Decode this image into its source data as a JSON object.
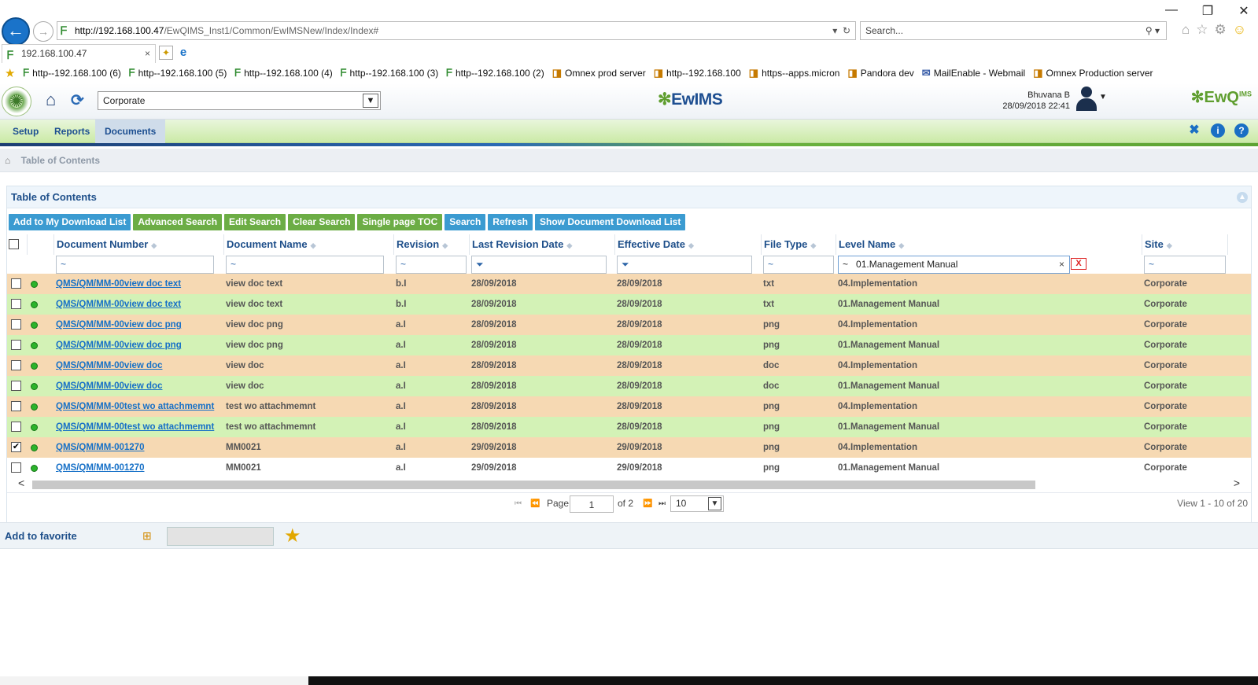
{
  "browser": {
    "url_host": "http://192.168.100.47",
    "url_path": "/EwQIMS_Inst1/Common/EwIMSNew/Index/Index#",
    "search_placeholder": "Search...",
    "tab_title": "192.168.100.47",
    "favorites": [
      {
        "label": "http--192.168.100 (6)",
        "icon": "ewims-favicon"
      },
      {
        "label": "http--192.168.100 (5)",
        "icon": "ewims-favicon"
      },
      {
        "label": "http--192.168.100 (4)",
        "icon": "ewims-favicon"
      },
      {
        "label": "http--192.168.100 (3)",
        "icon": "ewims-favicon"
      },
      {
        "label": "http--192.168.100 (2)",
        "icon": "ewims-favicon"
      },
      {
        "label": "Omnex prod server",
        "icon": "ie-page-icon"
      },
      {
        "label": "http--192.168.100",
        "icon": "ie-page-icon"
      },
      {
        "label": "https--apps.micron",
        "icon": "ie-page-icon"
      },
      {
        "label": "Pandora dev",
        "icon": "ie-page-icon"
      },
      {
        "label": "MailEnable - Webmail",
        "icon": "mail-icon"
      },
      {
        "label": "Omnex Production server",
        "icon": "ie-page-icon"
      }
    ]
  },
  "header": {
    "site_selected": "Corporate",
    "brand": "EwIMS",
    "user_name": "Bhuvana B",
    "datetime": "28/09/2018 22:41",
    "brand_right": "EwQ",
    "brand_right_sup": "IMS"
  },
  "menu": {
    "items": [
      "Setup",
      "Reports",
      "Documents"
    ],
    "active": "Documents"
  },
  "breadcrumb": {
    "current": "Table of Contents"
  },
  "panel": {
    "title": "Table of Contents",
    "buttons": [
      {
        "label": "Add to My Download List",
        "color": "blue"
      },
      {
        "label": "Advanced Search",
        "color": "green"
      },
      {
        "label": "Edit Search",
        "color": "green"
      },
      {
        "label": "Clear Search",
        "color": "green"
      },
      {
        "label": "Single page TOC",
        "color": "green"
      },
      {
        "label": "Search",
        "color": "blue"
      },
      {
        "label": "Refresh",
        "color": "blue"
      },
      {
        "label": "Show Document Download List",
        "color": "blue"
      }
    ]
  },
  "grid": {
    "columns": [
      "Document Number",
      "Document Name",
      "Revision",
      "Last Revision Date",
      "Effective Date",
      "File Type",
      "Level Name",
      "Site"
    ],
    "filters": {
      "document_number": "~",
      "document_name": "~",
      "revision": "~",
      "last_revision_date": "",
      "effective_date": "",
      "file_type": "~",
      "level_name_prefix": "~",
      "level_name_value": "01.Management Manual",
      "site": "~"
    },
    "rows": [
      {
        "number": "QMS/QM/MM-00view doc text",
        "name": "view doc text",
        "revision": "b.I",
        "last_rev": "28/09/2018",
        "effective": "28/09/2018",
        "type": "txt",
        "level": "04.Implementation",
        "site": "Corporate",
        "checked": false,
        "tone": "orange"
      },
      {
        "number": "QMS/QM/MM-00view doc text",
        "name": "view doc text",
        "revision": "b.I",
        "last_rev": "28/09/2018",
        "effective": "28/09/2018",
        "type": "txt",
        "level": "01.Management Manual",
        "site": "Corporate",
        "checked": false,
        "tone": "green"
      },
      {
        "number": "QMS/QM/MM-00view doc png",
        "name": "view doc png",
        "revision": "a.I",
        "last_rev": "28/09/2018",
        "effective": "28/09/2018",
        "type": "png",
        "level": "04.Implementation",
        "site": "Corporate",
        "checked": false,
        "tone": "orange"
      },
      {
        "number": "QMS/QM/MM-00view doc png",
        "name": "view doc png",
        "revision": "a.I",
        "last_rev": "28/09/2018",
        "effective": "28/09/2018",
        "type": "png",
        "level": "01.Management Manual",
        "site": "Corporate",
        "checked": false,
        "tone": "green"
      },
      {
        "number": "QMS/QM/MM-00view doc",
        "name": "view doc",
        "revision": "a.I",
        "last_rev": "28/09/2018",
        "effective": "28/09/2018",
        "type": "doc",
        "level": "04.Implementation",
        "site": "Corporate",
        "checked": false,
        "tone": "orange"
      },
      {
        "number": "QMS/QM/MM-00view doc",
        "name": "view doc",
        "revision": "a.I",
        "last_rev": "28/09/2018",
        "effective": "28/09/2018",
        "type": "doc",
        "level": "01.Management Manual",
        "site": "Corporate",
        "checked": false,
        "tone": "green"
      },
      {
        "number": "QMS/QM/MM-00test wo attachmemnt",
        "name": "test wo attachmemnt",
        "revision": "a.I",
        "last_rev": "28/09/2018",
        "effective": "28/09/2018",
        "type": "png",
        "level": "04.Implementation",
        "site": "Corporate",
        "checked": false,
        "tone": "orange"
      },
      {
        "number": "QMS/QM/MM-00test wo attachmemnt",
        "name": "test wo attachmemnt",
        "revision": "a.I",
        "last_rev": "28/09/2018",
        "effective": "28/09/2018",
        "type": "png",
        "level": "01.Management Manual",
        "site": "Corporate",
        "checked": false,
        "tone": "green"
      },
      {
        "number": "QMS/QM/MM-001270",
        "name": "MM0021",
        "revision": "a.I",
        "last_rev": "29/09/2018",
        "effective": "29/09/2018",
        "type": "png",
        "level": "04.Implementation",
        "site": "Corporate",
        "checked": true,
        "tone": "orange"
      },
      {
        "number": "QMS/QM/MM-001270",
        "name": "MM0021",
        "revision": "a.I",
        "last_rev": "29/09/2018",
        "effective": "29/09/2018",
        "type": "png",
        "level": "01.Management Manual",
        "site": "Corporate",
        "checked": false,
        "tone": "white"
      }
    ]
  },
  "pager": {
    "page_label": "Page",
    "page_value": "1",
    "of_label": "of 2",
    "page_size": "10",
    "view_text": "View 1 - 10 of 20"
  },
  "favorite": {
    "label": "Add to favorite"
  },
  "colors": {
    "row_orange": "#f6d9b3",
    "row_green": "#d3f2b6",
    "button_blue": "#3b9bd1",
    "button_green": "#6cad45",
    "link": "#1670c7"
  }
}
